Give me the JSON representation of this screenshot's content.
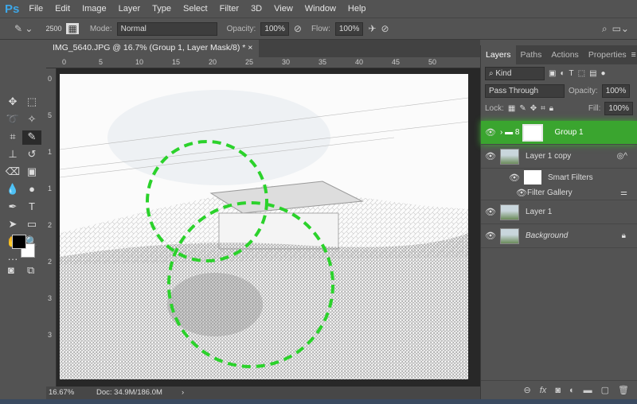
{
  "app": {
    "logo": "Ps"
  },
  "menu": [
    "File",
    "Edit",
    "Image",
    "Layer",
    "Type",
    "Select",
    "Filter",
    "3D",
    "View",
    "Window",
    "Help"
  ],
  "options": {
    "brush_size": "2500",
    "mode_label": "Mode:",
    "mode_value": "Normal",
    "opacity_label": "Opacity:",
    "opacity_value": "100%",
    "flow_label": "Flow:",
    "flow_value": "100%"
  },
  "document": {
    "tab_title": "IMG_5640.JPG @ 16.7% (Group 1, Layer Mask/8) *",
    "close": "×",
    "ruler_top": [
      "0",
      "5",
      "10",
      "15",
      "20",
      "25",
      "30",
      "35",
      "40",
      "45",
      "50"
    ],
    "ruler_left": [
      "0",
      "5",
      "1",
      "1",
      "2",
      "2",
      "3",
      "3"
    ],
    "zoom": "16.67%",
    "doc_size": "Doc: 34.9M/186.0M",
    "arrow": "›"
  },
  "colors": {
    "selection": "#2bd22b",
    "highlight": "#3aa52f"
  },
  "layers_panel": {
    "tabs": [
      "Layers",
      "Paths",
      "Actions",
      "Properties"
    ],
    "filter_kind": "Kind",
    "blend_mode": "Pass Through",
    "opacity_label": "Opacity:",
    "opacity_value": "100%",
    "lock_label": "Lock:",
    "fill_label": "Fill:",
    "fill_value": "100%",
    "layers": [
      {
        "name": "Group 1",
        "selected": true
      },
      {
        "name": "Layer 1 copy"
      },
      {
        "name": "Smart Filters"
      },
      {
        "name": "Filter Gallery"
      },
      {
        "name": "Layer 1"
      },
      {
        "name": "Background",
        "locked": true
      }
    ]
  }
}
